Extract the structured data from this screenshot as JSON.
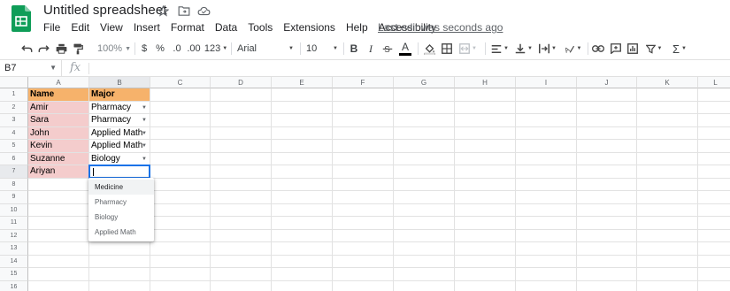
{
  "title_bar": {
    "doc_title": "Untitled spreadsheet",
    "last_edit": "Last edit was seconds ago"
  },
  "menu": [
    "File",
    "Edit",
    "View",
    "Insert",
    "Format",
    "Data",
    "Tools",
    "Extensions",
    "Help",
    "Accessibility"
  ],
  "toolbar": {
    "currency": "$",
    "percent": "%",
    "decrease_decimal": ".0",
    "increase_decimal": ".00",
    "number_format": "123",
    "font": "Arial",
    "font_size": "10",
    "bold": "B",
    "italic": "I",
    "underline_text_color": "A"
  },
  "formula_bar": {
    "cell_ref": "B7",
    "fx": "fx",
    "value": ""
  },
  "grid": {
    "columns": [
      "A",
      "B",
      "C",
      "D",
      "E",
      "F",
      "G",
      "H",
      "I",
      "J",
      "K",
      "L"
    ],
    "rows": [
      "1",
      "2",
      "3",
      "4",
      "5",
      "6",
      "7",
      "8",
      "9",
      "10",
      "11",
      "12",
      "13",
      "14",
      "15",
      "16"
    ],
    "selected_column": "B",
    "selected_row": "7",
    "header_color": "#f6b26b",
    "name_color": "#f4cccc",
    "data": [
      [
        "Name",
        "Major"
      ],
      [
        "Amir",
        "Pharmacy"
      ],
      [
        "Sara",
        "Pharmacy"
      ],
      [
        "John",
        "Applied Math"
      ],
      [
        "Kevin",
        "Applied Math"
      ],
      [
        "Suzanne",
        "Biology"
      ],
      [
        "Ariyan",
        ""
      ]
    ]
  },
  "dropdown": {
    "options": [
      "Medicine",
      "Pharmacy",
      "Biology",
      "Applied Math"
    ],
    "highlighted": "Medicine"
  },
  "colors": {
    "accent": "#1a73e8",
    "sheets_green": "#0f9d58"
  }
}
